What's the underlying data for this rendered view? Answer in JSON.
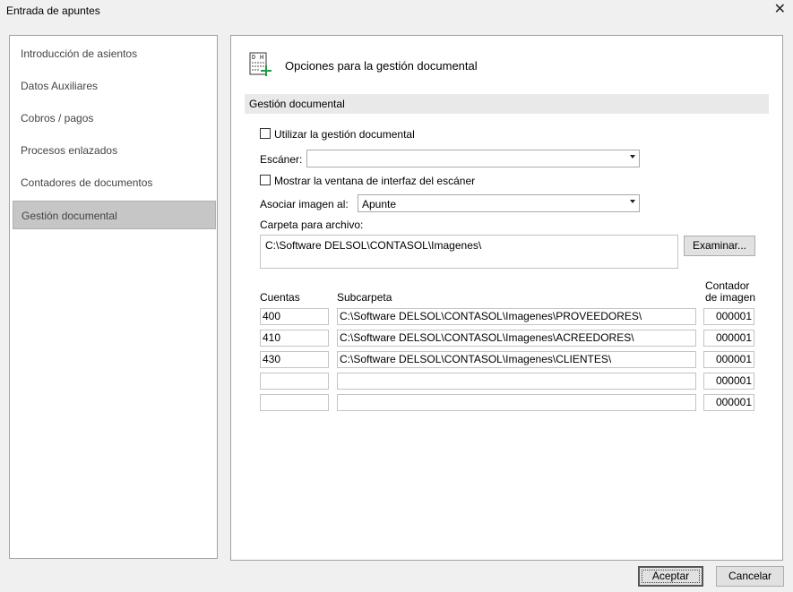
{
  "window": {
    "title": "Entrada de apuntes",
    "close_glyph": "✕"
  },
  "sidebar": {
    "items": [
      {
        "label": "Introducción de asientos",
        "selected": false
      },
      {
        "label": "Datos Auxiliares",
        "selected": false
      },
      {
        "label": "Cobros / pagos",
        "selected": false
      },
      {
        "label": "Procesos enlazados",
        "selected": false
      },
      {
        "label": "Contadores de documentos",
        "selected": false
      },
      {
        "label": "Gestión documental",
        "selected": true
      }
    ]
  },
  "panel": {
    "icon": "document-add-icon",
    "title": "Opciones para la gestión documental",
    "section": "Gestión documental",
    "use_doc_mgmt": {
      "label": "Utilizar la gestión documental",
      "checked": false
    },
    "scanner": {
      "label": "Escáner:",
      "value": ""
    },
    "show_scanner_ui": {
      "label": "Mostrar la ventana de interfaz del escáner",
      "checked": false
    },
    "associate": {
      "label": "Asociar imagen al:",
      "value": "Apunte"
    },
    "folder": {
      "label": "Carpeta para archivo:",
      "value": "C:\\Software DELSOL\\CONTASOL\\Imagenes\\",
      "browse_label": "Examinar..."
    },
    "table": {
      "headers": {
        "accounts": "Cuentas",
        "subfolder": "Subcarpeta",
        "counter_line1": "Contador",
        "counter_line2": "de imagen"
      },
      "rows": [
        {
          "account": "400",
          "subfolder": "C:\\Software DELSOL\\CONTASOL\\Imagenes\\PROVEEDORES\\",
          "counter": "000001"
        },
        {
          "account": "410",
          "subfolder": "C:\\Software DELSOL\\CONTASOL\\Imagenes\\ACREEDORES\\",
          "counter": "000001"
        },
        {
          "account": "430",
          "subfolder": "C:\\Software DELSOL\\CONTASOL\\Imagenes\\CLIENTES\\",
          "counter": "000001"
        },
        {
          "account": "",
          "subfolder": "",
          "counter": "000001"
        },
        {
          "account": "",
          "subfolder": "",
          "counter": "000001"
        }
      ]
    }
  },
  "footer": {
    "accept_label": "Aceptar",
    "cancel_label": "Cancelar"
  }
}
